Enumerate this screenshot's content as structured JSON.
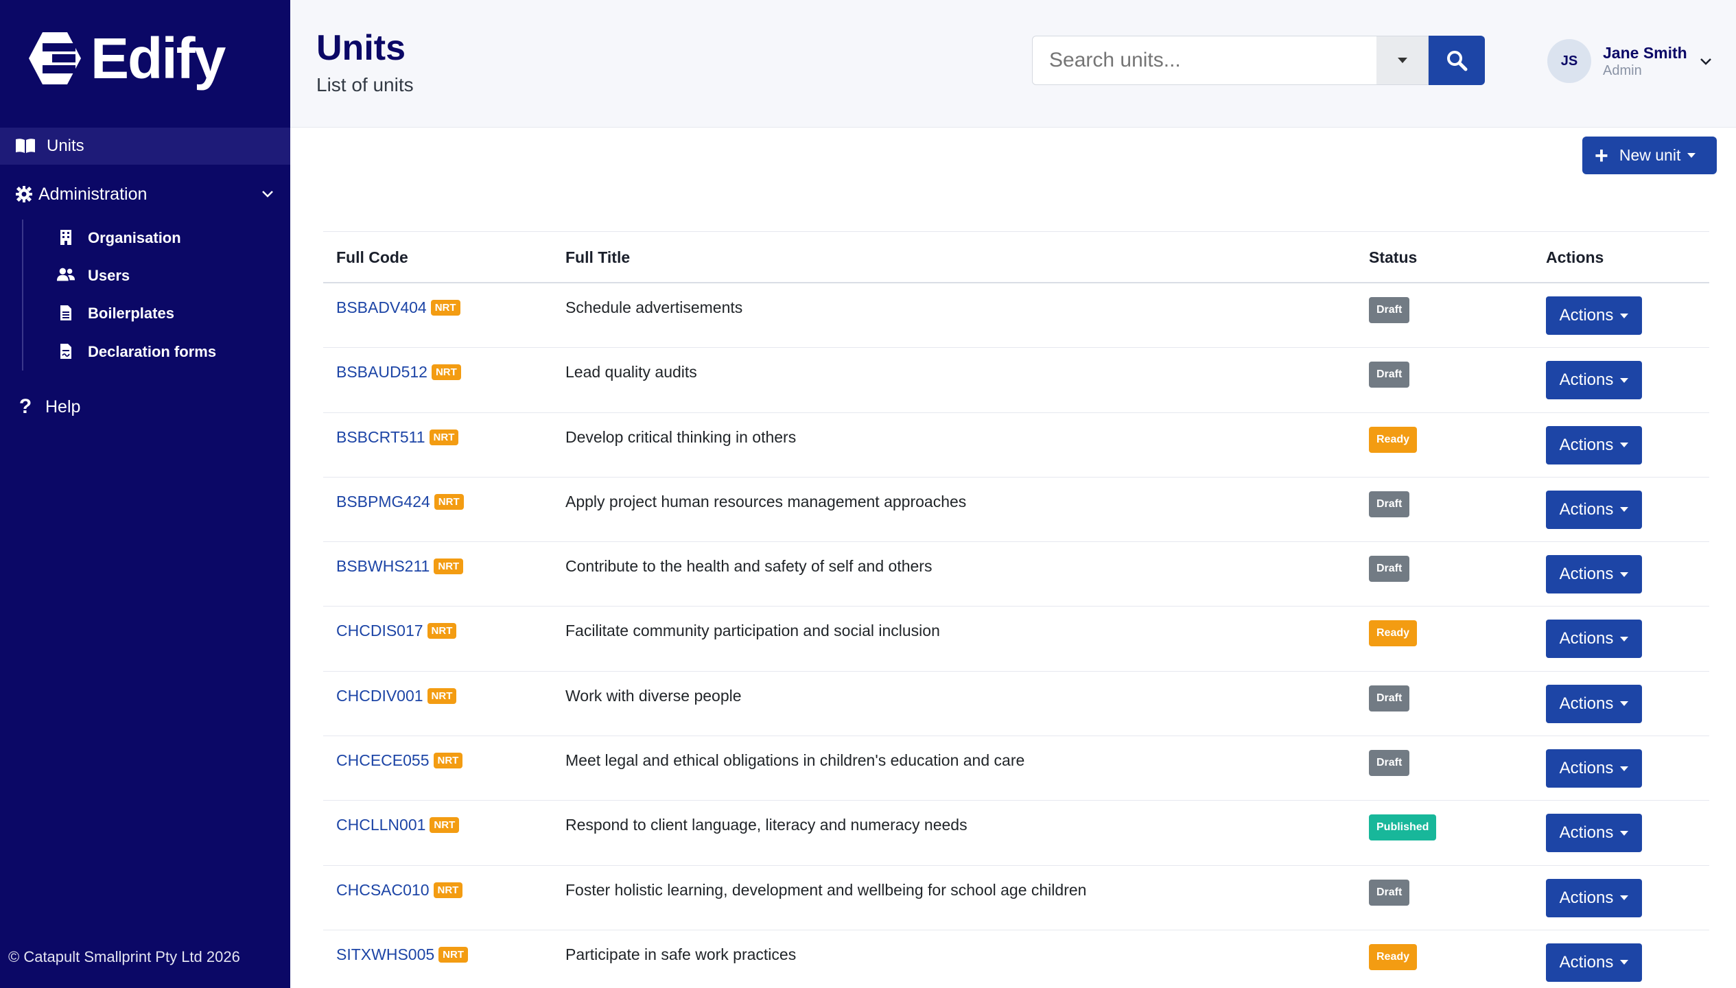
{
  "app": {
    "brand": "Edify"
  },
  "sidebar": {
    "units_label": "Units",
    "admin_label": "Administration",
    "admin_items": [
      {
        "label": "Organisation",
        "icon": "building-icon"
      },
      {
        "label": "Users",
        "icon": "users-icon"
      },
      {
        "label": "Boilerplates",
        "icon": "file-icon"
      },
      {
        "label": "Declaration forms",
        "icon": "file-signature-icon"
      }
    ],
    "help_label": "Help",
    "copyright": "© Catapult Smallprint Pty Ltd 2026"
  },
  "header": {
    "title": "Units",
    "subtitle": "List of units",
    "search_placeholder": "Search units...",
    "user_initials": "JS",
    "user_name": "Jane Smith",
    "user_role": "Admin"
  },
  "toolbar": {
    "new_unit_label": "New unit"
  },
  "table": {
    "columns": [
      "Full Code",
      "Full Title",
      "Status",
      "Actions"
    ],
    "badge_label": "NRT",
    "actions_label": "Actions",
    "rows": [
      {
        "code": "BSBADV404",
        "title": "Schedule advertisements",
        "status": "Draft"
      },
      {
        "code": "BSBAUD512",
        "title": "Lead quality audits",
        "status": "Draft"
      },
      {
        "code": "BSBCRT511",
        "title": "Develop critical thinking in others",
        "status": "Ready"
      },
      {
        "code": "BSBPMG424",
        "title": "Apply project human resources management approaches",
        "status": "Draft"
      },
      {
        "code": "BSBWHS211",
        "title": "Contribute to the health and safety of self and others",
        "status": "Draft"
      },
      {
        "code": "CHCDIS017",
        "title": "Facilitate community participation and social inclusion",
        "status": "Ready"
      },
      {
        "code": "CHCDIV001",
        "title": "Work with diverse people",
        "status": "Draft"
      },
      {
        "code": "CHCECE055",
        "title": "Meet legal and ethical obligations in children's education and care",
        "status": "Draft"
      },
      {
        "code": "CHCLLN001",
        "title": "Respond to client language, literacy and numeracy needs",
        "status": "Published"
      },
      {
        "code": "CHCSAC010",
        "title": "Foster holistic learning, development and wellbeing for school age children",
        "status": "Draft"
      },
      {
        "code": "SITXWHS005",
        "title": "Participate in safe work practices",
        "status": "Ready"
      }
    ]
  },
  "colors": {
    "sidebar_bg": "#0b0866",
    "primary": "#1d45a6",
    "draft": "#727b84",
    "ready": "#f39c12",
    "published": "#18b79a"
  }
}
